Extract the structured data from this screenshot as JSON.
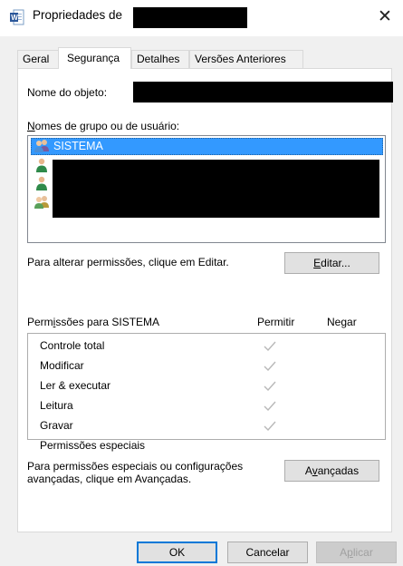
{
  "window": {
    "title": "Propriedades de",
    "close_glyph": "✕",
    "icon": "word-document-icon"
  },
  "tabs": [
    {
      "label": "Geral"
    },
    {
      "label": "Segurança"
    },
    {
      "label": "Detalhes"
    },
    {
      "label": "Versões Anteriores"
    }
  ],
  "active_tab": "Segurança",
  "security": {
    "object_label": "Nome do objeto:",
    "groups_label_u": "N",
    "groups_label_rest": "omes de grupo ou de usuário:",
    "groups": [
      {
        "name": "SISTEMA",
        "icon": "group-icon",
        "selected": true
      },
      {
        "name": "",
        "icon": "user-icon",
        "selected": false
      },
      {
        "name": "",
        "icon": "user-icon",
        "selected": false
      },
      {
        "name": "",
        "icon": "group-icon",
        "selected": false
      }
    ],
    "change_text": "Para alterar permissões, clique em Editar.",
    "edit_button_u": "E",
    "edit_button_rest": "ditar...",
    "permissions_title_pre": "Perm",
    "permissions_title_u": "i",
    "permissions_title_post": "ssões para SISTEMA",
    "allow_header": "Permitir",
    "deny_header": "Negar",
    "permissions": [
      {
        "name": "Controle total",
        "allow": true,
        "deny": false
      },
      {
        "name": "Modificar",
        "allow": true,
        "deny": false
      },
      {
        "name": "Ler & executar",
        "allow": true,
        "deny": false
      },
      {
        "name": "Leitura",
        "allow": true,
        "deny": false
      },
      {
        "name": "Gravar",
        "allow": true,
        "deny": false
      },
      {
        "name": "Permissões especiais",
        "allow": false,
        "deny": false
      }
    ],
    "advanced_text_line1": "Para permissões especiais ou configurações",
    "advanced_text_line2": "avançadas, clique em Avançadas.",
    "advanced_button_pre": "A",
    "advanced_button_u": "v",
    "advanced_button_post": "ançadas"
  },
  "footer": {
    "ok": "OK",
    "cancel": "Cancelar",
    "apply_pre": "A",
    "apply_u": "p",
    "apply_post": "licar"
  },
  "colors": {
    "selection": "#3399ff",
    "checkmark": "#b8b8b8",
    "primary_border": "#0078d7",
    "redaction": "#000000"
  }
}
